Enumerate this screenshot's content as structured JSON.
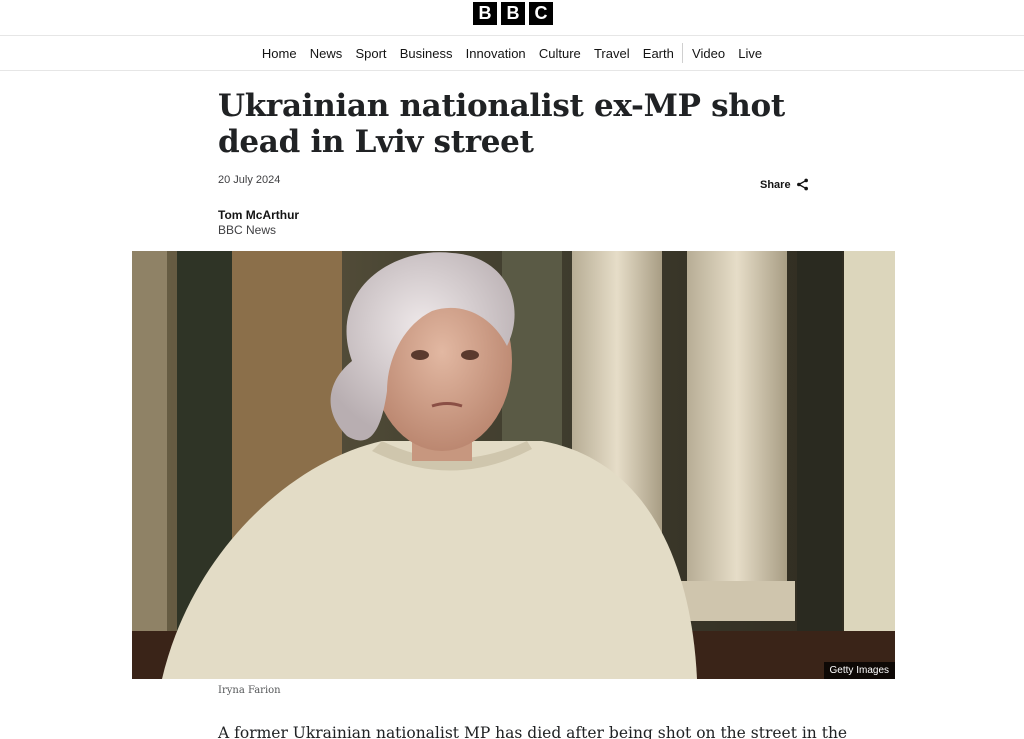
{
  "header": {
    "logo_letters": [
      "B",
      "B",
      "C"
    ]
  },
  "nav": {
    "items": [
      "Home",
      "News",
      "Sport",
      "Business",
      "Innovation",
      "Culture",
      "Travel",
      "Earth",
      "Video",
      "Live"
    ]
  },
  "article": {
    "headline": "Ukrainian nationalist ex-MP shot dead in Lviv street",
    "date": "20 July 2024",
    "share_label": "Share",
    "share_icon": "share-icon",
    "author": "Tom McArthur",
    "author_org": "BBC News",
    "image_credit": "Getty Images",
    "image_caption": "Iryna Farion",
    "lede": "A former Ukrainian nationalist MP has died after being shot on the street in the"
  },
  "colors": {
    "text": "#141414",
    "logo_bg": "#000000",
    "border": "#e6e6e6"
  }
}
